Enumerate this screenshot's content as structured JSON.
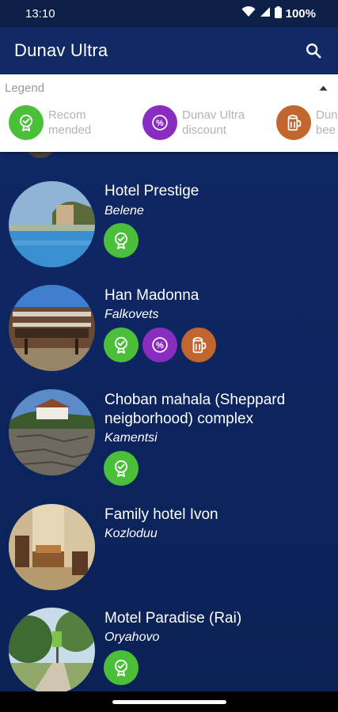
{
  "status_bar": {
    "time": "13:10",
    "battery": "100%"
  },
  "app_bar": {
    "title": "Dunav Ultra",
    "search_icon": "search-icon"
  },
  "legend": {
    "title": "Legend",
    "items": [
      {
        "icon": "recommended-icon",
        "label_line1": "Recom",
        "label_line2": "mended",
        "color": "#4cbf3a"
      },
      {
        "icon": "discount-icon",
        "label_line1": "Dunav Ultra",
        "label_line2": "discount",
        "color": "#8a2cc0"
      },
      {
        "icon": "beer-icon",
        "label_line1": "Dun",
        "label_line2": "bee",
        "color": "#c0662e"
      }
    ]
  },
  "hotels": [
    {
      "name": "Hotel Prestige",
      "town": "Belene",
      "badges": [
        "recommended"
      ]
    },
    {
      "name": "Han Madonna",
      "town": "Falkovets",
      "badges": [
        "recommended",
        "discount",
        "beer"
      ]
    },
    {
      "name": "Choban mahala (Sheppard neigborhood) complex",
      "town": "Kamentsi",
      "badges": [
        "recommended"
      ]
    },
    {
      "name": "Family hotel Ivon",
      "town": "Kozloduu",
      "badges": []
    },
    {
      "name": "Motel Paradise (Rai)",
      "town": "Oryahovo",
      "badges": [
        "recommended"
      ]
    }
  ]
}
